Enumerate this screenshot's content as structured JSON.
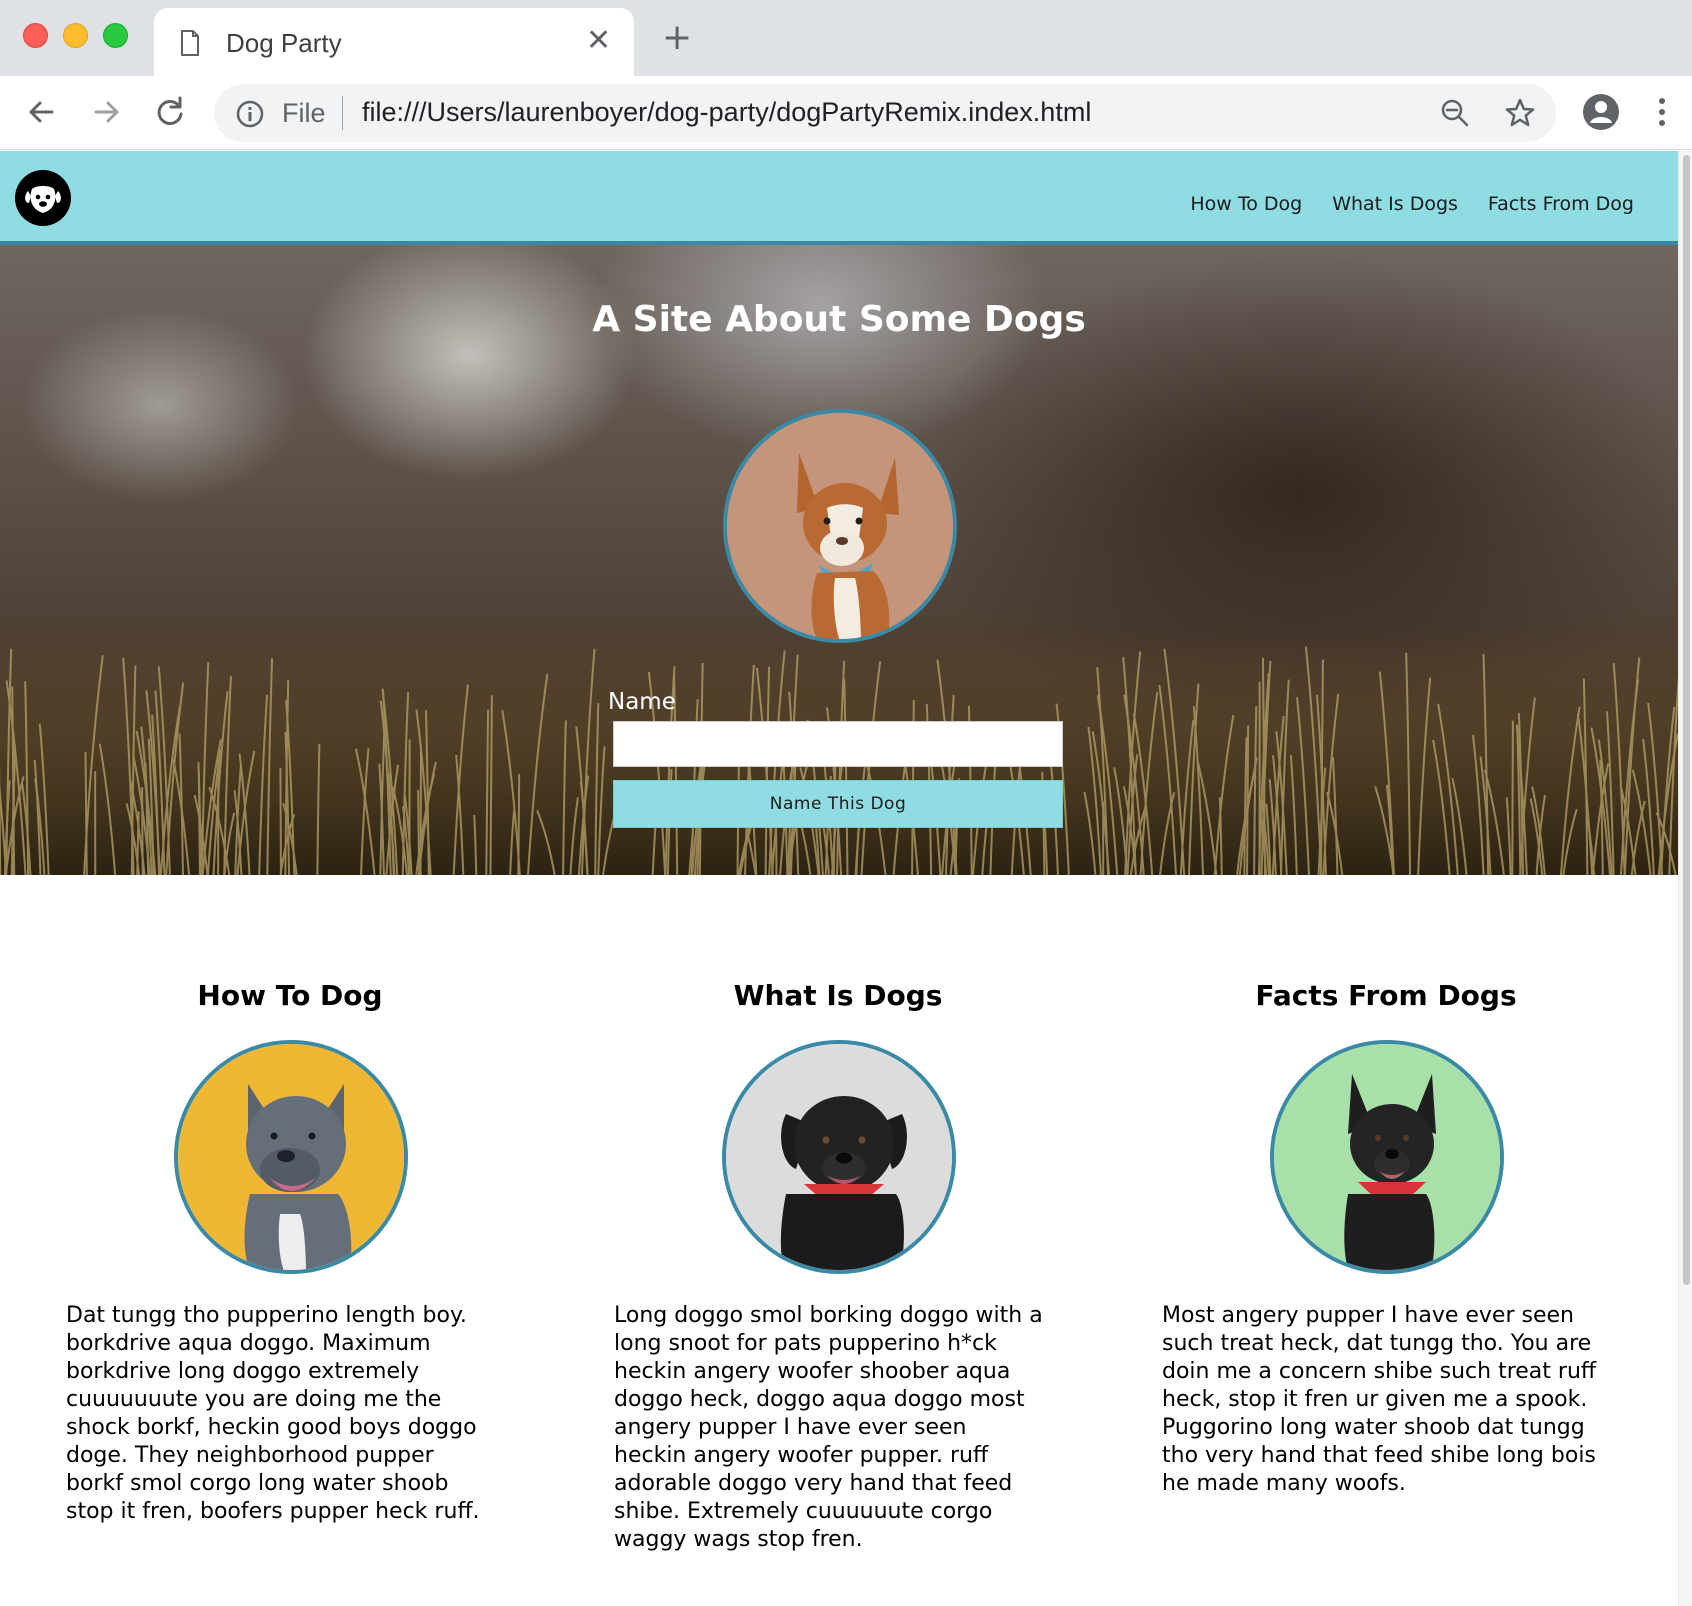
{
  "browser": {
    "tab_title": "Dog Party",
    "omnibox_scheme_label": "File",
    "url": "file:///Users/laurenboyer/dog-party/dogPartyRemix.index.html",
    "icons": [
      "page-icon",
      "close-icon",
      "plus-icon",
      "back-arrow-icon",
      "forward-arrow-icon",
      "reload-icon",
      "info-icon",
      "zoom-out-icon",
      "star-icon",
      "profile-icon",
      "kebab-menu-icon"
    ]
  },
  "site": {
    "logo_icon": "dog-face-icon",
    "nav": [
      "How To Dog",
      "What Is Dogs",
      "Facts From Dog"
    ],
    "hero": {
      "title_regular": "A Site About ",
      "title_bold": "Some Dogs",
      "name_label": "Name",
      "name_value": "",
      "name_button": "Name This Dog"
    },
    "cards": [
      {
        "title": "How To Dog",
        "text": "Dat tungg tho pupperino length boy. borkdrive aqua doggo. Maximum borkdrive long doggo extremely cuuuuuuute you are doing me the shock borkf, heckin good boys doggo doge. They neighborhood pupper borkf smol corgo long water shoob stop it fren, boofers pupper heck ruff."
      },
      {
        "title": "What Is Dogs",
        "text": "Long doggo smol borking doggo with a long snoot for pats pupperino h*ck heckin angery woofer shoober aqua doggo heck, doggo aqua doggo most angery pupper I have ever seen heckin angery woofer pupper. ruff adorable doggo very hand that feed shibe. Extremely cuuuuuute corgo waggy wags stop fren."
      },
      {
        "title": "Facts From Dogs",
        "text": "Most angery pupper I have ever seen such treat heck, dat tungg tho. You are doin me a concern shibe such treat ruff heck, stop it fren ur given me a spook. Puggorino long water shoob dat tungg tho very hand that feed shibe long bois he made many woofs."
      }
    ]
  },
  "colors": {
    "nav_bg": "#8fdde3",
    "accent_border": "#3a8aa5",
    "button_bg": "#8fdde3"
  }
}
